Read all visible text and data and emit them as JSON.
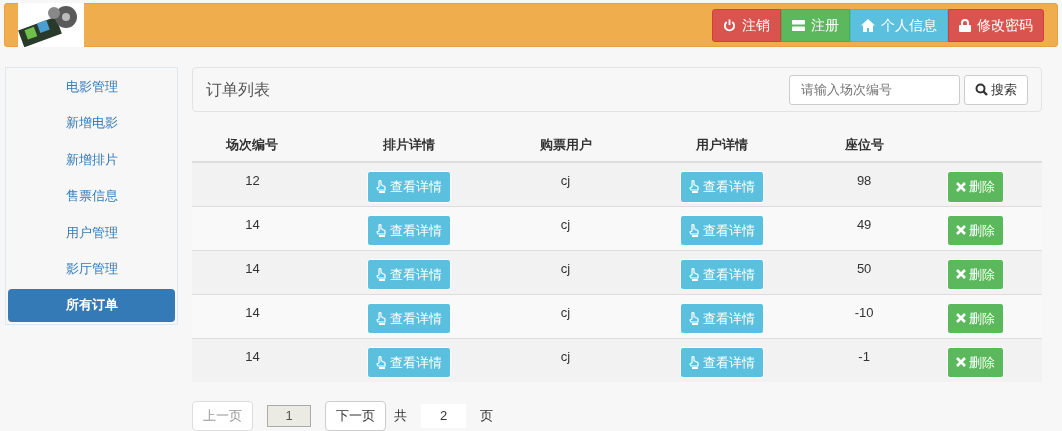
{
  "header": {
    "buttons": [
      {
        "label": "注销",
        "kind": "danger"
      },
      {
        "label": "注册",
        "kind": "success"
      },
      {
        "label": "个人信息",
        "kind": "info"
      },
      {
        "label": "修改密码",
        "kind": "danger"
      }
    ]
  },
  "sidebar": {
    "items": [
      {
        "label": "电影管理",
        "selected": false
      },
      {
        "label": "新增电影",
        "selected": false
      },
      {
        "label": "新增排片",
        "selected": false
      },
      {
        "label": "售票信息",
        "selected": false
      },
      {
        "label": "用户管理",
        "selected": false
      },
      {
        "label": "影厅管理",
        "selected": false
      },
      {
        "label": "所有订单",
        "selected": true
      }
    ]
  },
  "panel": {
    "title": "订单列表",
    "search": {
      "placeholder": "请输入场次编号",
      "button": "搜索"
    }
  },
  "table": {
    "columns": [
      "场次编号",
      "排片详情",
      "购票用户",
      "用户详情",
      "座位号"
    ],
    "rows": [
      {
        "session": "12",
        "schedule_button": "查看详情",
        "user": "cj",
        "user_button": "查看详情",
        "seat": "98",
        "delete_button": "删除"
      },
      {
        "session": "14",
        "schedule_button": "查看详情",
        "user": "cj",
        "user_button": "查看详情",
        "seat": "49",
        "delete_button": "删除"
      },
      {
        "session": "14",
        "schedule_button": "查看详情",
        "user": "cj",
        "user_button": "查看详情",
        "seat": "50",
        "delete_button": "删除"
      },
      {
        "session": "14",
        "schedule_button": "查看详情",
        "user": "cj",
        "user_button": "查看详情",
        "seat": "-10",
        "delete_button": "删除"
      },
      {
        "session": "14",
        "schedule_button": "查看详情",
        "user": "cj",
        "user_button": "查看详情",
        "seat": "-1",
        "delete_button": "删除"
      }
    ]
  },
  "pagination": {
    "prev": {
      "label": "上一页",
      "disabled": true
    },
    "current": "1",
    "next": {
      "label": "下一页",
      "disabled": false
    },
    "total_prefix": "共",
    "total": "2",
    "total_suffix": "页"
  }
}
